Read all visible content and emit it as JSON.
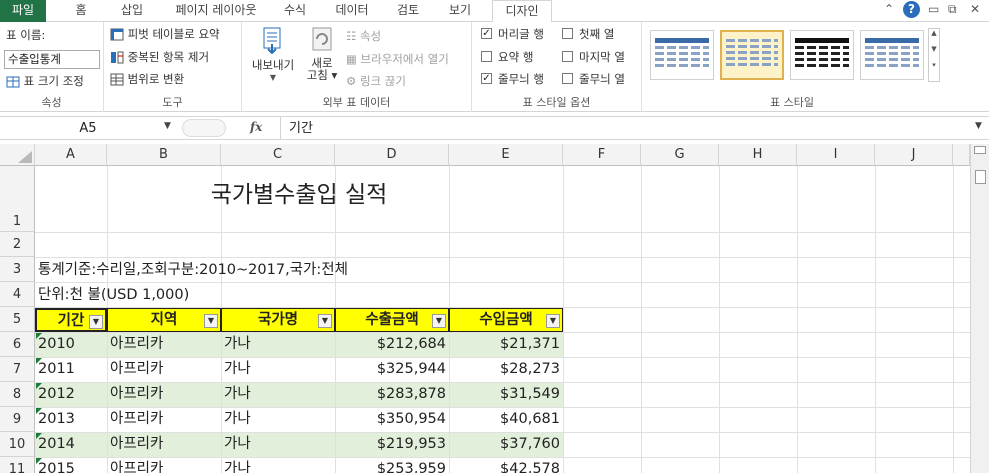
{
  "tabs": {
    "file": "파일",
    "home": "홈",
    "insert": "삽입",
    "page_layout": "페이지 레이아웃",
    "formulas": "수식",
    "data": "데이터",
    "review": "검토",
    "view": "보기",
    "design": "디자인"
  },
  "ribbon": {
    "properties": {
      "table_name_label": "표 이름:",
      "table_name_value": "수출입통계",
      "resize_label": "표 크기 조정",
      "group_label": "속성"
    },
    "tools": {
      "pivot_label": "피벗 테이블로 요약",
      "remove_dup_label": "중복된 항목 제거",
      "convert_label": "범위로 변환",
      "group_label": "도구"
    },
    "external": {
      "export_label": "내보내기",
      "refresh_label_1": "새로",
      "refresh_label_2": "고침",
      "properties_label": "속성",
      "open_browser_label": "브라우저에서 열기",
      "unlink_label": "링크 끊기",
      "group_label": "외부 표 데이터"
    },
    "style_options": {
      "header_row": "머리글 행",
      "total_row": "요약 행",
      "banded_rows": "줄무늬 행",
      "first_column": "첫째 열",
      "last_column": "마지막 열",
      "banded_columns": "줄무늬 열",
      "header_row_checked": true,
      "total_row_checked": false,
      "banded_rows_checked": true,
      "first_column_checked": false,
      "last_column_checked": false,
      "banded_columns_checked": false,
      "group_label": "표 스타일 옵션"
    },
    "table_styles": {
      "group_label": "표 스타일"
    }
  },
  "formula_bar": {
    "name_box": "A5",
    "fx": "fx",
    "formula": "기간"
  },
  "columns": [
    "A",
    "B",
    "C",
    "D",
    "E",
    "F",
    "G",
    "H",
    "I",
    "J"
  ],
  "rows": [
    "1",
    "2",
    "3",
    "4",
    "5",
    "6",
    "7",
    "8",
    "9",
    "10",
    "11"
  ],
  "sheet": {
    "title": "국가별수출입 실적",
    "criteria": "통계기준:수리일,조회구분:2010~2017,국가:전체",
    "unit": "단위:천 불(USD 1,000)",
    "headers": [
      "기간",
      "지역",
      "국가명",
      "수출금액",
      "수입금액"
    ],
    "data": [
      [
        "2010",
        "아프리카",
        "가나",
        "$212,684",
        "$21,371"
      ],
      [
        "2011",
        "아프리카",
        "가나",
        "$325,944",
        "$28,273"
      ],
      [
        "2012",
        "아프리카",
        "가나",
        "$283,878",
        "$31,549"
      ],
      [
        "2013",
        "아프리카",
        "가나",
        "$350,954",
        "$40,681"
      ],
      [
        "2014",
        "아프리카",
        "가나",
        "$219,953",
        "$37,760"
      ],
      [
        "2015",
        "아프리카",
        "가나",
        "$253,959",
        "$42,578"
      ]
    ]
  },
  "colors": {
    "file_tab": "#217346",
    "header_fill": "#ffff00",
    "band_fill": "#e2efda"
  }
}
